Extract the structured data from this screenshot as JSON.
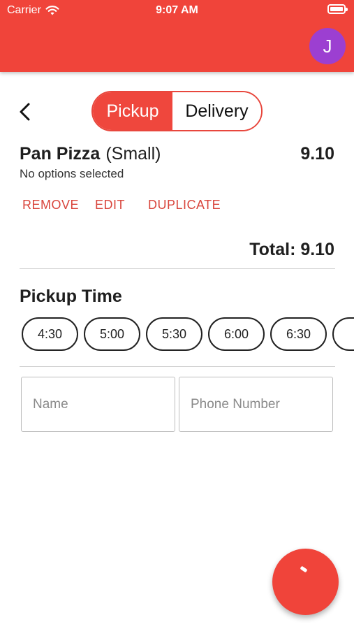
{
  "status_bar": {
    "carrier": "Carrier",
    "time": "9:07 AM"
  },
  "user": {
    "avatar_initial": "J",
    "avatar_color": "#9c3fd1"
  },
  "theme": {
    "accent": "#f0443a"
  },
  "order_type": {
    "options": [
      "Pickup",
      "Delivery"
    ],
    "selected": "Pickup"
  },
  "cart": {
    "item": {
      "name": "Pan Pizza",
      "size": "(Small)",
      "price": "9.10",
      "options": "No options selected"
    },
    "actions": {
      "remove": "REMOVE",
      "edit": "EDIT",
      "duplicate": "DUPLICATE"
    },
    "total": "Total: 9.10"
  },
  "pickup_time": {
    "heading": "Pickup Time",
    "slots": [
      "4:30",
      "5:00",
      "5:30",
      "6:00",
      "6:30"
    ]
  },
  "form": {
    "name_placeholder": "Name",
    "phone_placeholder": "Phone Number"
  }
}
